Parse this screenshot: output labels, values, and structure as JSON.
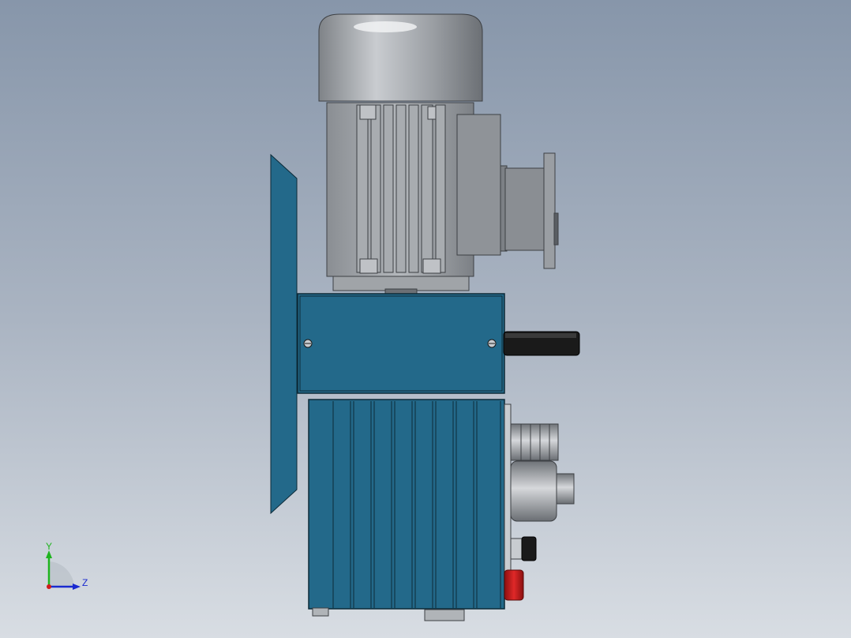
{
  "scene": {
    "model": "motor-pump-assembly",
    "view_orientation": "side"
  },
  "colors": {
    "background_top": "#8796aa",
    "background_bottom": "#d8dde3",
    "housing_blue": "#23698a",
    "motor_grey": "#8f9398",
    "knob_red": "#c81e1e",
    "handle_black": "#1a1a1a"
  },
  "triad": {
    "y_label": "Y",
    "z_label": "Z",
    "y_color": "#1fb41f",
    "z_color": "#1a2ad0",
    "origin_color": "#d01a1a"
  }
}
